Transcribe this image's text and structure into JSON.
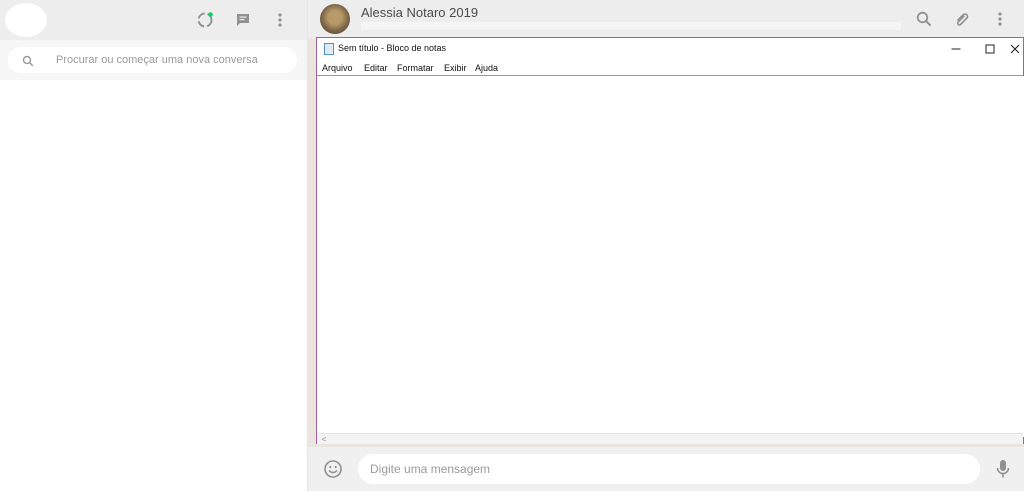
{
  "sidebar": {
    "search": {
      "placeholder": "Procurar ou começar uma nova conversa"
    },
    "header": {
      "icons": [
        "status-icon",
        "new-chat-icon",
        "menu-icon"
      ]
    }
  },
  "chat": {
    "contact_name": "Alessia Notaro 2019",
    "header_icons": [
      "search-icon",
      "attach-icon",
      "menu-icon"
    ],
    "composer": {
      "placeholder": "Digite uma mensagem",
      "icons": [
        "emoji-icon",
        "microphone-icon"
      ]
    }
  },
  "notepad": {
    "title": "Sem título - Bloco de notas",
    "menu": [
      "Arquivo",
      "Editar",
      "Formatar",
      "Exibir",
      "Ajuda"
    ],
    "window_buttons": [
      "minimize",
      "maximize",
      "close"
    ]
  },
  "colors": {
    "window_border": "#a25ea2",
    "menu_rule": "#59b8b0",
    "status_dot": "#09d261"
  }
}
